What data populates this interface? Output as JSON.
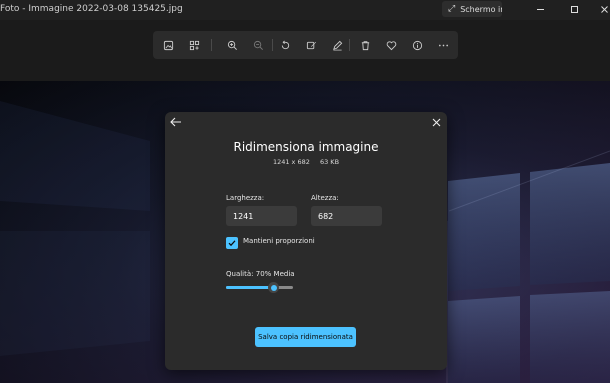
{
  "window": {
    "title": "Foto - Immagine 2022-03-08 135425.jpg",
    "fullscreen_label": "Schermo intero"
  },
  "toolbar": {
    "icons": [
      "image-icon",
      "add-to-album-icon",
      "zoom-in-icon",
      "zoom-out-icon",
      "rotate-icon",
      "edit-icon",
      "draw-icon",
      "delete-icon",
      "favorite-icon",
      "info-icon",
      "more-icon"
    ]
  },
  "dialog": {
    "title": "Ridimensiona immagine",
    "dimensions": "1241 x 682",
    "file_size": "63 KB",
    "width_label": "Larghezza:",
    "width_value": "1241",
    "height_label": "Altezza:",
    "height_value": "682",
    "keep_ratio_label": "Mantieni proporzioni",
    "keep_ratio_checked": true,
    "quality_label": "Qualità: 70% Media",
    "quality_value": 0.7,
    "save_label": "Salva copia ridimensionata"
  },
  "colors": {
    "accent": "#4cc2ff",
    "dialog_bg": "#2b2b2b",
    "window_bg": "#202020"
  }
}
